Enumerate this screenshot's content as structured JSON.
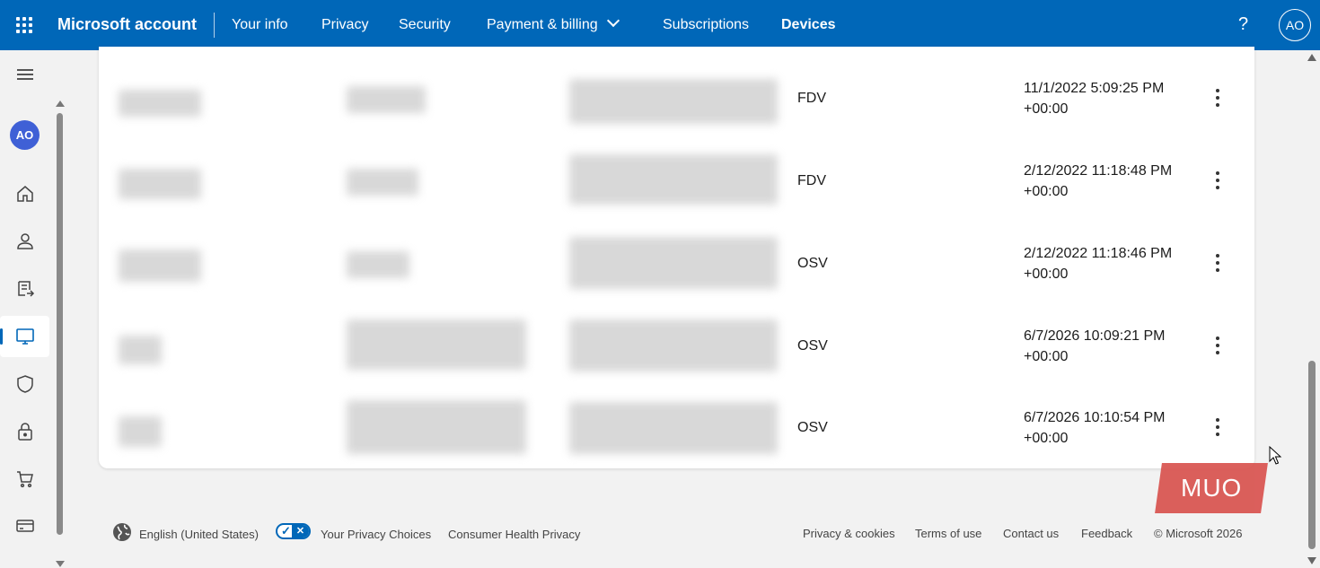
{
  "header": {
    "brand": "Microsoft account",
    "nav": [
      {
        "label": "Your info"
      },
      {
        "label": "Privacy"
      },
      {
        "label": "Security"
      },
      {
        "label": "Payment & billing"
      },
      {
        "label": "Subscriptions"
      },
      {
        "label": "Devices"
      }
    ],
    "help": "?",
    "avatar_initials": "AO"
  },
  "sidebar": {
    "avatar_initials": "AO",
    "items": [
      {
        "icon": "home-icon"
      },
      {
        "icon": "person-icon"
      },
      {
        "icon": "billing-icon"
      },
      {
        "icon": "devices-icon",
        "active": true
      },
      {
        "icon": "shield-icon"
      },
      {
        "icon": "lock-icon"
      },
      {
        "icon": "cart-icon"
      },
      {
        "icon": "card-icon"
      }
    ]
  },
  "table": {
    "rows": [
      {
        "type": "FDV",
        "date_line1": "11/1/2022 5:09:25 PM",
        "date_line2": "+00:00"
      },
      {
        "type": "FDV",
        "date_line1": "2/12/2022 11:18:48 PM",
        "date_line2": "+00:00"
      },
      {
        "type": "OSV",
        "date_line1": "2/12/2022 11:18:46 PM",
        "date_line2": "+00:00"
      },
      {
        "type": "OSV",
        "date_line1": "6/7/2026 10:09:21 PM",
        "date_line2": "+00:00"
      },
      {
        "type": "OSV",
        "date_line1": "6/7/2026 10:10:54 PM",
        "date_line2": "+00:00"
      }
    ]
  },
  "footer": {
    "language": "English (United States)",
    "privacy_choices": "Your Privacy Choices",
    "health_privacy": "Consumer Health Privacy",
    "privacy_cookies": "Privacy & cookies",
    "terms": "Terms of use",
    "contact": "Contact us",
    "feedback": "Feedback",
    "copyright": "© Microsoft 2026"
  },
  "watermark": "MUO",
  "colors": {
    "accent": "#0067b8",
    "avatar": "#3f60d6",
    "watermark": "#d9534f"
  }
}
